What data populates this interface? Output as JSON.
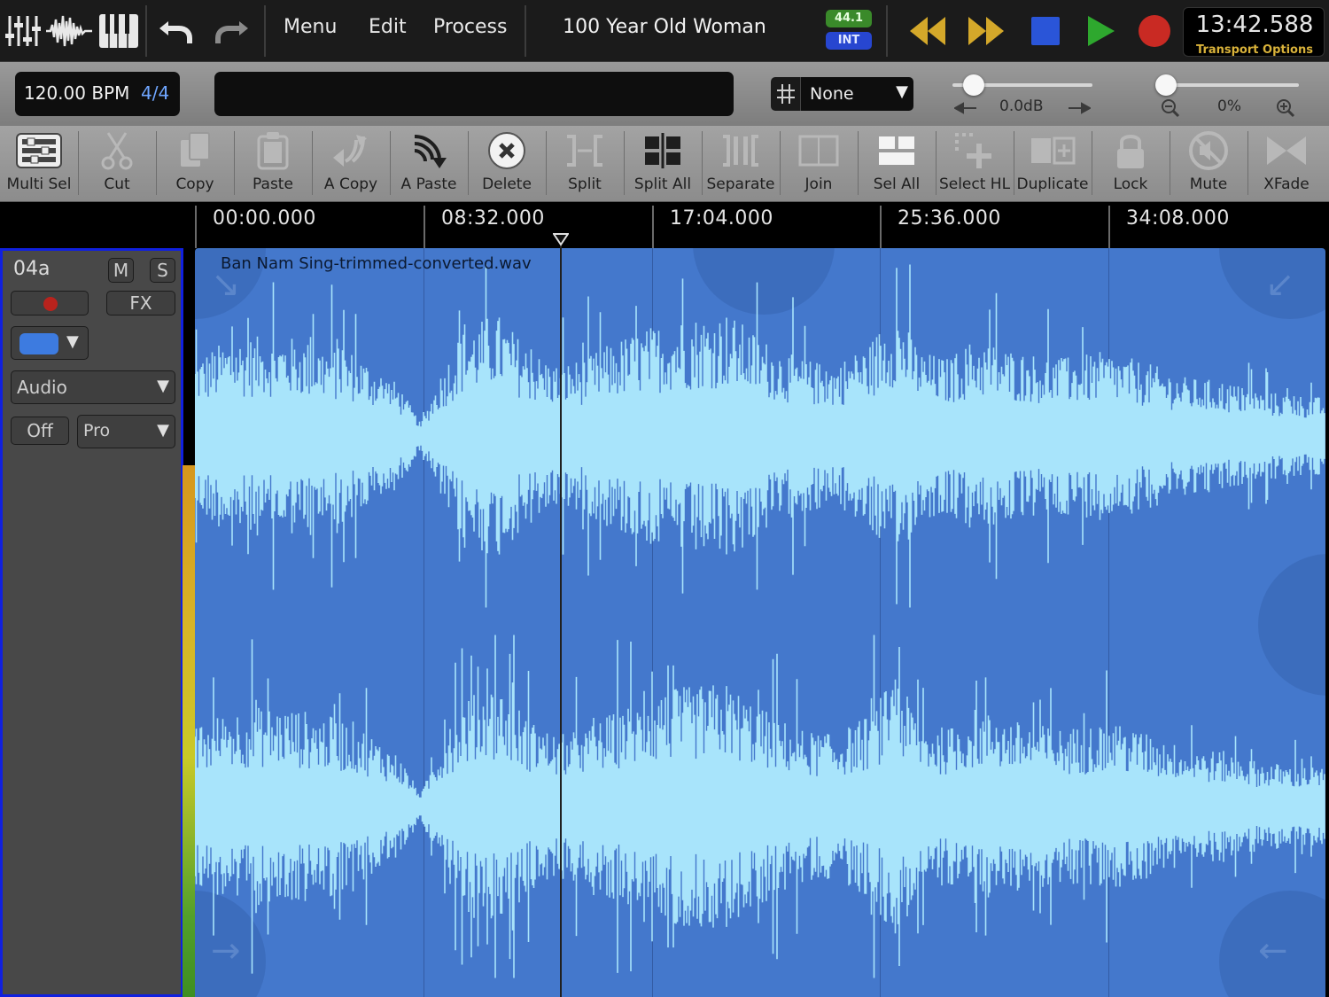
{
  "topbar": {
    "icons": [
      "mixer-icon",
      "waveform-icon",
      "piano-keys-icon",
      "undo-icon",
      "redo-icon"
    ],
    "menu": [
      "Menu",
      "Edit",
      "Process"
    ],
    "song_title": "100 Year Old Woman",
    "sample_rate": "44.1",
    "clock_source": "INT",
    "transport_buttons": [
      "rewind",
      "fast-forward",
      "stop",
      "play",
      "record"
    ],
    "time": "13:42.588",
    "transport_options": "Transport Options",
    "colors": {
      "rewind": "#d4a82a",
      "stop": "#2a55d8",
      "play": "#2ea82e",
      "record": "#c92a23",
      "sample_rate_bg": "#3a8a2a",
      "clock_bg": "#2746d0"
    }
  },
  "bar2": {
    "bpm": "120.00 BPM",
    "time_signature": "4/4",
    "snap_value": "None",
    "volume": {
      "value": "0.0dB",
      "level": 0.15
    },
    "zoom": {
      "value": "0%",
      "level": 0.05
    }
  },
  "toolbar": [
    {
      "label": "Multi Sel",
      "icon": "multi-select-icon",
      "enabled": true
    },
    {
      "label": "Cut",
      "icon": "scissors-icon",
      "enabled": false
    },
    {
      "label": "Copy",
      "icon": "copy-icon",
      "enabled": false
    },
    {
      "label": "Paste",
      "icon": "clipboard-icon",
      "enabled": false
    },
    {
      "label": "A Copy",
      "icon": "audio-copy-icon",
      "enabled": false
    },
    {
      "label": "A Paste",
      "icon": "audio-paste-icon",
      "enabled": true
    },
    {
      "label": "Delete",
      "icon": "delete-icon",
      "enabled": true
    },
    {
      "label": "Split",
      "icon": "split-icon",
      "enabled": false
    },
    {
      "label": "Split All",
      "icon": "split-all-icon",
      "enabled": true
    },
    {
      "label": "Separate",
      "icon": "separate-icon",
      "enabled": false
    },
    {
      "label": "Join",
      "icon": "join-icon",
      "enabled": false
    },
    {
      "label": "Sel All",
      "icon": "select-all-icon",
      "enabled": true
    },
    {
      "label": "Select HL",
      "icon": "select-highlight-icon",
      "enabled": false
    },
    {
      "label": "Duplicate",
      "icon": "duplicate-icon",
      "enabled": false
    },
    {
      "label": "Lock",
      "icon": "lock-icon",
      "enabled": false
    },
    {
      "label": "Mute",
      "icon": "mute-icon",
      "enabled": false
    },
    {
      "label": "XFade",
      "icon": "crossfade-icon",
      "enabled": false
    }
  ],
  "ruler": {
    "ticks": [
      "00:00.000",
      "08:32.000",
      "17:04.000",
      "25:36.000",
      "34:08.000"
    ]
  },
  "track": {
    "name": "04a",
    "mute": "M",
    "solo": "S",
    "fx": "FX",
    "type": "Audio",
    "automation": "Off",
    "mode": "Pro",
    "color": "#3d7be0"
  },
  "clip": {
    "file_name": "Ban Nam Sing-trimmed-converted.wav",
    "color": "#4478cc",
    "wave_color": "#a8e4fb"
  }
}
